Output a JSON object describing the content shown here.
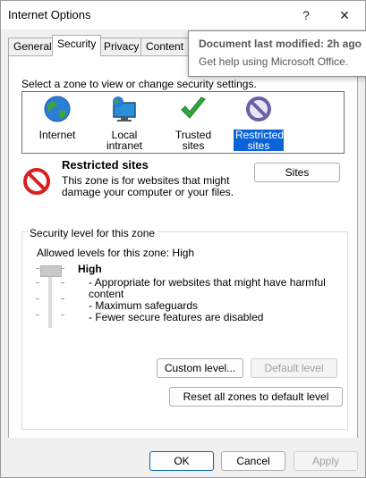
{
  "window": {
    "title": "Internet Options",
    "help_glyph": "?",
    "close_glyph": "✕"
  },
  "tabs": [
    {
      "label": "General"
    },
    {
      "label": "Security"
    },
    {
      "label": "Privacy"
    },
    {
      "label": "Content"
    }
  ],
  "tooltip": {
    "title": "Document last modified: 2h ago",
    "subtitle": "Get help using Microsoft Office."
  },
  "security": {
    "instruction": "Select a zone to view or change security settings.",
    "zones": [
      {
        "label": "Internet",
        "icon": "globe-icon"
      },
      {
        "label": "Local intranet",
        "icon": "computer-globe-icon"
      },
      {
        "label": "Trusted sites",
        "icon": "checkmark-icon"
      },
      {
        "label_line1": "Restricted",
        "label_line2": "sites",
        "icon": "restricted-icon",
        "selected": true
      }
    ],
    "selected_zone": {
      "title": "Restricted sites",
      "desc_line1": "This zone is for websites that might",
      "desc_line2": "damage your computer or your files."
    },
    "sites_button": "Sites",
    "level_group": {
      "caption": "Security level for this zone",
      "allowed": "Allowed levels for this zone: High",
      "level_name": "High",
      "bullets": [
        "- Appropriate for websites that might have harmful",
        "content",
        "- Maximum safeguards",
        "- Fewer secure features are disabled"
      ],
      "custom_level_button": "Custom level...",
      "default_level_button": "Default level"
    },
    "reset_button": "Reset all zones to default level"
  },
  "footer": {
    "ok": "OK",
    "cancel": "Cancel",
    "apply": "Apply"
  },
  "colors": {
    "selection": "#0a64d8",
    "restricted_red": "#d92020",
    "trusted_green": "#2fa83a",
    "restricted_purple": "#6b5fa8"
  }
}
